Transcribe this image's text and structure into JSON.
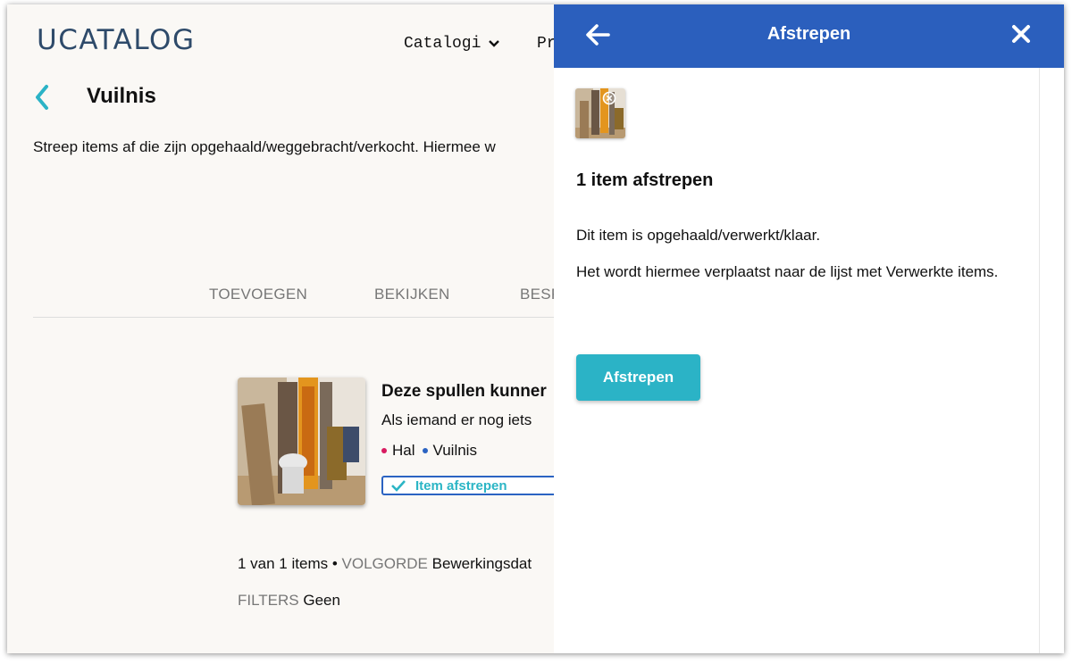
{
  "colors": {
    "header_blue": "#2b5fbd",
    "accent_teal": "#2bb3c6",
    "logo_navy": "#2e4a6a",
    "tag_hal": "#d81b60",
    "tag_vuilnis": "#2b63c2"
  },
  "nav": {
    "logo": "UCATALOG",
    "catalogi": "Catalogi",
    "catalogi_icon": "chevron-down-icon",
    "truncated_item": "Pr"
  },
  "page": {
    "back_icon": "chevron-left-icon",
    "title": "Vuilnis",
    "intro": "Streep items af die zijn opgehaald/weggebracht/verkocht. Hiermee w"
  },
  "tabs": [
    "TOEVOEGEN",
    "BEKIJKEN",
    "BESP"
  ],
  "item": {
    "title": "Deze spullen kunner",
    "description": "Als iemand er nog iets",
    "tags": [
      {
        "name": "Hal",
        "color": "#d81b60"
      },
      {
        "name": "Vuilnis",
        "color": "#2b63c2"
      }
    ],
    "action_label": "Item afstrepen",
    "action_icon": "checkmark-icon"
  },
  "list_meta": {
    "count": "1 van 1 items •",
    "order_label": "VOLGORDE",
    "order_value": "Bewerkingsdat",
    "filters_label": "FILTERS",
    "filters_value": "Geen"
  },
  "panel": {
    "title": "Afstrepen",
    "back_icon": "arrow-left-icon",
    "close_icon": "close-icon",
    "remove_icon": "remove-circle-icon",
    "heading": "1 item afstrepen",
    "paragraph1": "Dit item is opgehaald/verwerkt/klaar.",
    "paragraph2": "Het wordt hiermee verplaatst naar de lijst met Verwerkte items.",
    "button_label": "Afstrepen"
  }
}
